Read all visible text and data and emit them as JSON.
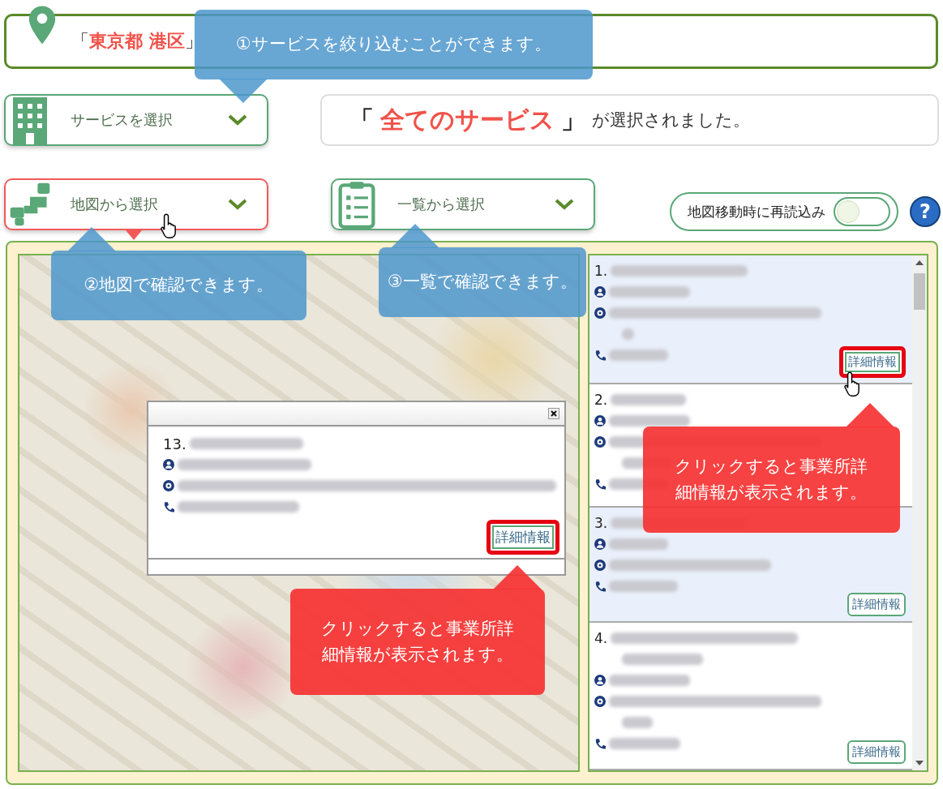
{
  "location_bar": {
    "open_bracket": "「",
    "prefecture": "東京都",
    "ward": "港区",
    "close_bracket": "」"
  },
  "service_selector": {
    "label": "サービスを選択"
  },
  "selection_status": {
    "open_bracket": "「",
    "service": "全てのサービス",
    "close_bracket": "」",
    "suffix": "が選択されました。"
  },
  "view_selectors": [
    {
      "kind": "map",
      "label": "地図から選択",
      "selected": true
    },
    {
      "kind": "list",
      "label": "一覧から選択",
      "selected": false
    }
  ],
  "reload_toggle": {
    "label": "地図移動時に再読込み",
    "on": false
  },
  "help": {
    "label": "?"
  },
  "map_popup": {
    "number": "13.",
    "button": {
      "label": "詳細情報",
      "highlighted": true
    }
  },
  "results": [
    {
      "number": "1.",
      "shaded": true,
      "button": {
        "label": "詳細情報",
        "highlighted": true
      }
    },
    {
      "number": "2.",
      "shaded": false
    },
    {
      "number": "3.",
      "shaded": true,
      "button": {
        "label": "詳細情報",
        "highlighted": false
      }
    },
    {
      "number": "4.",
      "shaded": false,
      "button": {
        "label": "詳細情報",
        "highlighted": false
      }
    }
  ],
  "callouts": [
    {
      "kind": "blue",
      "text": "①サービスを絞り込むことができます。"
    },
    {
      "kind": "blue",
      "text": "②地図で確認できます。"
    },
    {
      "kind": "blue",
      "text": "③一覧で確認できます。"
    },
    {
      "kind": "red",
      "text": "クリックすると事業所詳細情報が表示されます。"
    },
    {
      "kind": "red",
      "text": "クリックすると事業所詳細情報が表示されます。"
    }
  ]
}
